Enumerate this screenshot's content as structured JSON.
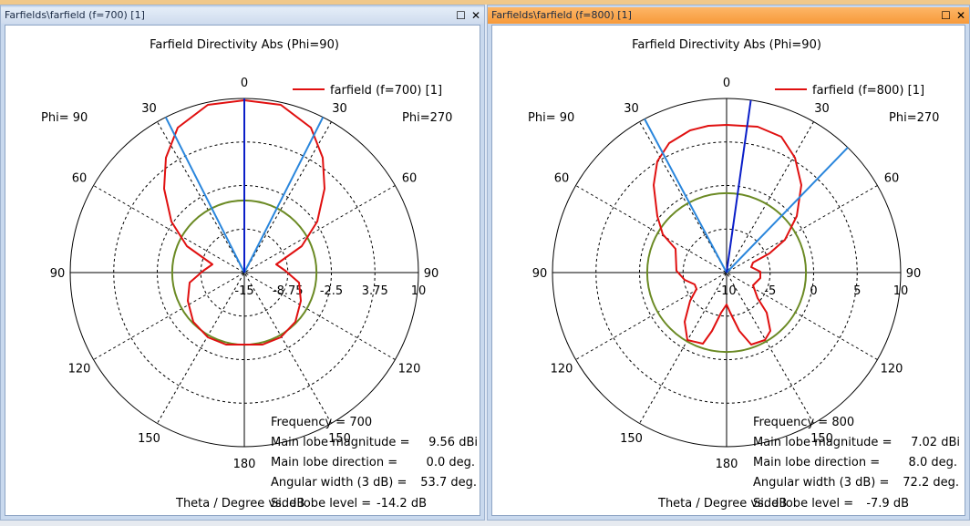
{
  "panels": [
    {
      "window_title": "Farfields\\farfield (f=700) [1]",
      "plot_title": "Farfield Directivity Abs (Phi=90)",
      "legend": "farfield (f=700) [1]",
      "phi_left": "Phi= 90",
      "phi_right": "Phi=270",
      "angle_labels": {
        "a0": "0",
        "a30l": "30",
        "a30r": "30",
        "a60l": "60",
        "a60r": "60",
        "a90l": "90",
        "a90r": "90",
        "a120l": "120",
        "a120r": "120",
        "a150l": "150",
        "a150r": "150",
        "a180": "180"
      },
      "radial_ticks": [
        "-15",
        "-8.75",
        "-2.5",
        "3.75",
        "10"
      ],
      "rmin": -15,
      "rmax": 10,
      "axis_label": "Theta / Degree vs. dB",
      "info": {
        "frequency": "Frequency = 700",
        "mag_label": "Main lobe magnitude =",
        "mag_value": "9.56 dBi",
        "dir_label": "Main lobe direction =",
        "dir_value": "0.0 deg.",
        "width_label": "Angular width (3 dB) =",
        "width_value": "53.7 deg.",
        "sll_label": "Side lobe level =",
        "sll_value": "-14.2 dB"
      },
      "main_lobe_dir": 0.0,
      "angular_width": 53.7,
      "main_lobe_mag": 9.56,
      "side_lobe_level": -14.2
    },
    {
      "window_title": "Farfields\\farfield (f=800) [1]",
      "plot_title": "Farfield Directivity Abs (Phi=90)",
      "legend": "farfield (f=800) [1]",
      "phi_left": "Phi= 90",
      "phi_right": "Phi=270",
      "angle_labels": {
        "a0": "0",
        "a30l": "30",
        "a30r": "30",
        "a60l": "60",
        "a60r": "60",
        "a90l": "90",
        "a90r": "90",
        "a120l": "120",
        "a120r": "120",
        "a150l": "150",
        "a150r": "150",
        "a180": "180"
      },
      "radial_ticks": [
        "-10",
        "-5",
        "0",
        "5",
        "10"
      ],
      "rmin": -10,
      "rmax": 10,
      "axis_label": "Theta / Degree vs. dB",
      "info": {
        "frequency": "Frequency = 800",
        "mag_label": "Main lobe magnitude =",
        "mag_value": "7.02 dBi",
        "dir_label": "Main lobe direction =",
        "dir_value": "8.0 deg.",
        "width_label": "Angular width (3 dB) =",
        "width_value": "72.2 deg.",
        "sll_label": "Side lobe level =",
        "sll_value": "-7.9 dB"
      },
      "main_lobe_dir": 8.0,
      "angular_width": 72.2,
      "main_lobe_mag": 7.02,
      "side_lobe_level": -7.9
    }
  ],
  "colors": {
    "curve": "#e01010",
    "main_lobe": "#0a1ec8",
    "width_lines": "#2a86dc",
    "side_lobe": "#6b8a24",
    "active_title": "#f79a3a"
  }
}
